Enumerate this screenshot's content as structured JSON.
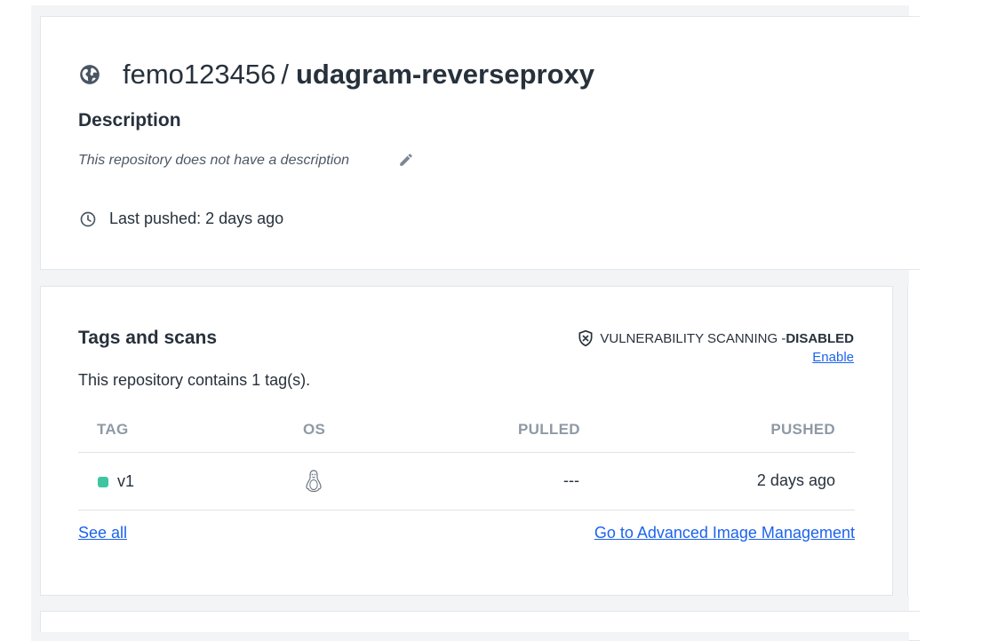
{
  "repo": {
    "namespace": "femo123456",
    "separator": "/",
    "name": "udagram-reverseproxy",
    "visibility_icon": "globe-icon",
    "description_heading": "Description",
    "description_text": "This repository does not have a description",
    "last_pushed": "Last pushed: 2 days ago"
  },
  "tags_section": {
    "heading": "Tags and scans",
    "vuln_label": "VULNERABILITY SCANNING - ",
    "vuln_status": "DISABLED",
    "enable_label": "Enable",
    "contains_text": "This repository contains 1 tag(s).",
    "columns": [
      "TAG",
      "OS",
      "PULLED",
      "PUSHED"
    ],
    "rows": [
      {
        "tag": "v1",
        "os_icon": "linux-icon",
        "pulled": "---",
        "pushed": "2 days ago",
        "status_color": "#3fc6a0"
      }
    ],
    "see_all_label": "See all",
    "advanced_label": "Go to Advanced Image Management"
  },
  "colors": {
    "link": "#1d63ed",
    "text": "#27313c",
    "muted_header": "#8f99a5",
    "status_active": "#3fc6a0"
  }
}
